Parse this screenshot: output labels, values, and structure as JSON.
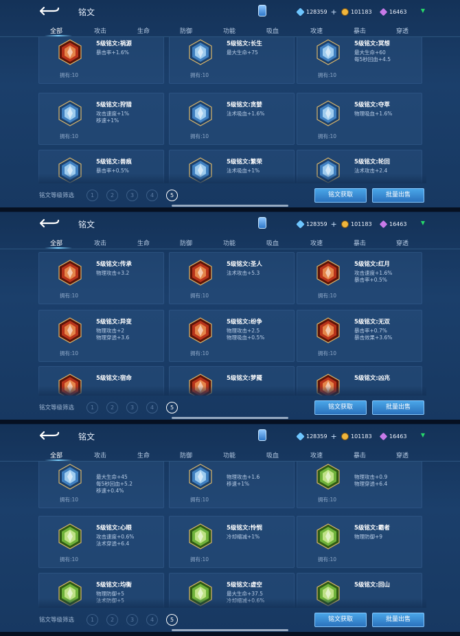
{
  "header": {
    "title": "铭文",
    "back": "back-arrow-icon",
    "badge": "rune-badge-icon"
  },
  "currency": {
    "coupons": "128359",
    "coupons_plus": "+",
    "gold": "101183",
    "gems": "16463"
  },
  "tabs": [
    "全部",
    "攻击",
    "生命",
    "防御",
    "功能",
    "吸血",
    "攻速",
    "暴击",
    "穿透"
  ],
  "filter": {
    "label": "铭文等级筛选",
    "levels": [
      "1",
      "2",
      "3",
      "4",
      "5"
    ],
    "selected": "5"
  },
  "buttons": {
    "acquire": "铭文获取",
    "bulk_sell": "批量出售"
  },
  "owned_label": "拥有:10",
  "colors": {
    "red": "#c8431e",
    "blue": "#4b8ec9",
    "green": "#7bbf38"
  },
  "screens": [
    {
      "cards": [
        {
          "name": "5级铭文:祸源",
          "attrs": [
            "暴击率+1.6%"
          ],
          "color": "red",
          "owned": "拥有:10"
        },
        {
          "name": "5级铭文:长生",
          "attrs": [
            "最大生命+75"
          ],
          "color": "blue",
          "owned": "拥有:10"
        },
        {
          "name": "5级铭文:冥想",
          "attrs": [
            "最大生命+60",
            "每5秒回血+4.5"
          ],
          "color": "blue",
          "owned": "拥有:10"
        },
        {
          "name": "5级铭文:狩猎",
          "attrs": [
            "攻击速度+1%",
            "移速+1%"
          ],
          "color": "blue",
          "owned": "拥有:10"
        },
        {
          "name": "5级铭文:贪婪",
          "attrs": [
            "法术吸血+1.6%"
          ],
          "color": "blue",
          "owned": "拥有:10"
        },
        {
          "name": "5级铭文:夺萃",
          "attrs": [
            "物理吸血+1.6%"
          ],
          "color": "blue",
          "owned": "拥有:10"
        },
        {
          "name": "5级铭文:兽痕",
          "attrs": [
            "暴击率+0.5%"
          ],
          "color": "blue",
          "owned": ""
        },
        {
          "name": "5级铭文:繁荣",
          "attrs": [
            "法术吸血+1%"
          ],
          "color": "blue",
          "owned": ""
        },
        {
          "name": "5级铭文:轮回",
          "attrs": [
            "法术攻击+2.4"
          ],
          "color": "blue",
          "owned": ""
        }
      ]
    },
    {
      "cards": [
        {
          "name": "5级铭文:传承",
          "attrs": [
            "物理攻击+3.2"
          ],
          "color": "red",
          "owned": "拥有:10"
        },
        {
          "name": "5级铭文:圣人",
          "attrs": [
            "法术攻击+5.3"
          ],
          "color": "red",
          "owned": "拥有:10"
        },
        {
          "name": "5级铭文:红月",
          "attrs": [
            "攻击速度+1.6%",
            "暴击率+0.5%"
          ],
          "color": "red",
          "owned": "拥有:10"
        },
        {
          "name": "5级铭文:异变",
          "attrs": [
            "物理攻击+2",
            "物理穿透+3.6"
          ],
          "color": "red",
          "owned": "拥有:10"
        },
        {
          "name": "5级铭文:纷争",
          "attrs": [
            "物理攻击+2.5",
            "物理吸血+0.5%"
          ],
          "color": "red",
          "owned": "拥有:10"
        },
        {
          "name": "5级铭文:无双",
          "attrs": [
            "暴击率+0.7%",
            "暴击效果+3.6%"
          ],
          "color": "red",
          "owned": "拥有:10"
        },
        {
          "name": "5级铭文:宿命",
          "attrs": [
            ""
          ],
          "color": "red",
          "owned": ""
        },
        {
          "name": "5级铭文:梦魇",
          "attrs": [
            ""
          ],
          "color": "red",
          "owned": ""
        },
        {
          "name": "5级铭文:凶兆",
          "attrs": [
            ""
          ],
          "color": "red",
          "owned": ""
        }
      ]
    },
    {
      "cards": [
        {
          "name": "",
          "attrs": [
            "最大生命+45",
            "每5秒回血+5.2",
            "移速+0.4%"
          ],
          "color": "blue",
          "owned": "拥有:10"
        },
        {
          "name": "",
          "attrs": [
            "物理攻击+1.6",
            "移速+1%"
          ],
          "color": "blue",
          "owned": "拥有:10"
        },
        {
          "name": "",
          "attrs": [
            "物理攻击+0.9",
            "物理穿透+6.4"
          ],
          "color": "green",
          "owned": "拥有:10"
        },
        {
          "name": "5级铭文:心眼",
          "attrs": [
            "攻击速度+0.6%",
            "法术穿透+6.4"
          ],
          "color": "green",
          "owned": "拥有:10"
        },
        {
          "name": "5级铭文:怜悯",
          "attrs": [
            "冷却缩减+1%"
          ],
          "color": "green",
          "owned": "拥有:10"
        },
        {
          "name": "5级铭文:霸者",
          "attrs": [
            "物理防御+9"
          ],
          "color": "green",
          "owned": "拥有:10"
        },
        {
          "name": "5级铭文:均衡",
          "attrs": [
            "物理防御+5",
            "法术防御+5"
          ],
          "color": "green",
          "owned": ""
        },
        {
          "name": "5级铭文:虚空",
          "attrs": [
            "最大生命+37.5",
            "冷却缩减+0.6%"
          ],
          "color": "green",
          "owned": ""
        },
        {
          "name": "5级铭文:回山",
          "attrs": [
            ""
          ],
          "color": "green",
          "owned": ""
        }
      ]
    }
  ]
}
